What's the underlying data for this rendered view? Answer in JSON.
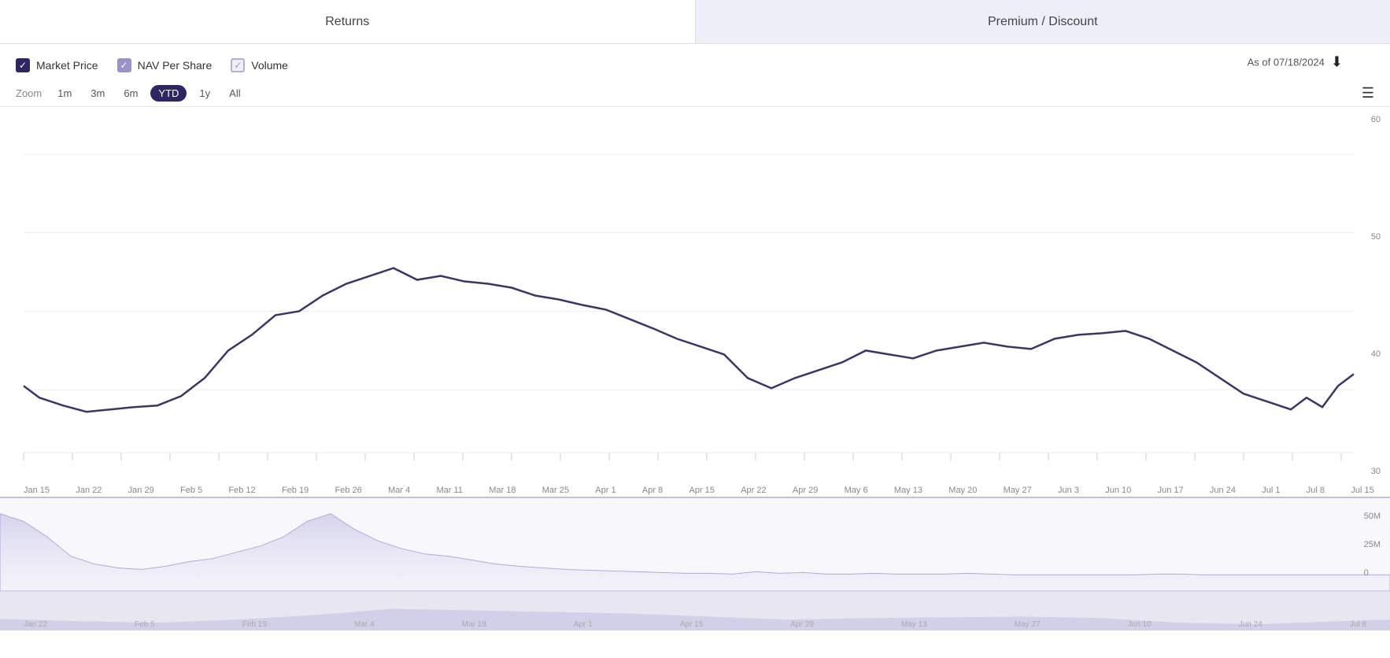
{
  "tabs": {
    "returns": "Returns",
    "premium_discount": "Premium / Discount"
  },
  "legend": {
    "market_price": "Market Price",
    "nav_per_share": "NAV Per Share",
    "volume": "Volume"
  },
  "as_of": "As of 07/18/2024",
  "zoom": {
    "label": "Zoom",
    "options": [
      "1m",
      "3m",
      "6m",
      "YTD",
      "1y",
      "All"
    ],
    "active": "YTD"
  },
  "y_axis": {
    "main": [
      "60",
      "50",
      "40",
      "30"
    ],
    "volume": [
      "50M",
      "25M",
      "0"
    ]
  },
  "x_axis": {
    "labels": [
      "Jan 15",
      "Jan 22",
      "Jan 29",
      "Feb 5",
      "Feb 12",
      "Feb 19",
      "Feb 26",
      "Mar 4",
      "Mar 11",
      "Mar 18",
      "Mar 25",
      "Apr 1",
      "Apr 8",
      "Apr 15",
      "Apr 22",
      "Apr 29",
      "May 6",
      "May 13",
      "May 20",
      "May 27",
      "Jun 3",
      "Jun 10",
      "Jun 17",
      "Jun 24",
      "Jul 1",
      "Jul 8",
      "Jul 15"
    ]
  },
  "minimap_labels": [
    "Jan 22",
    "Feb 5",
    "Feb 19",
    "Mar 4",
    "Mar 18",
    "Apr 1",
    "Apr 15",
    "Apr 29",
    "May 13",
    "May 27",
    "Jun 10",
    "Jun 24",
    "Jul 8"
  ]
}
